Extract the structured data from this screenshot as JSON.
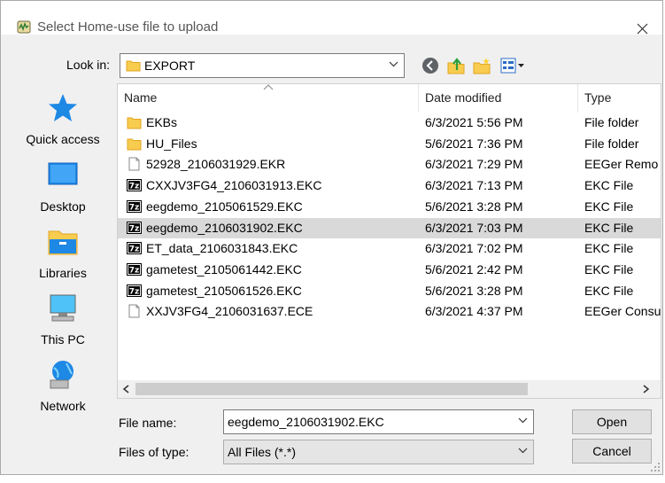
{
  "dialog": {
    "title": "Select Home-use file to upload",
    "look_in_label": "Look in:",
    "look_in_value": "EXPORT",
    "file_name_label": "File name:",
    "file_name_value": "eegdemo_2106031902.EKC",
    "files_of_type_label": "Files of type:",
    "files_of_type_value": "All Files (*.*)",
    "open_label": "Open",
    "cancel_label": "Cancel"
  },
  "places": [
    {
      "label": "Quick access",
      "icon": "star-icon"
    },
    {
      "label": "Desktop",
      "icon": "desktop-icon"
    },
    {
      "label": "Libraries",
      "icon": "libraries-icon"
    },
    {
      "label": "This PC",
      "icon": "computer-icon"
    },
    {
      "label": "Network",
      "icon": "network-icon"
    }
  ],
  "columns": {
    "name": "Name",
    "date": "Date modified",
    "type": "Type"
  },
  "files": [
    {
      "name": "EKBs",
      "date": "6/3/2021 5:56 PM",
      "type": "File folder",
      "icon": "folder"
    },
    {
      "name": "HU_Files",
      "date": "5/6/2021 7:36 PM",
      "type": "File folder",
      "icon": "folder"
    },
    {
      "name": "52928_2106031929.EKR",
      "date": "6/3/2021 7:29 PM",
      "type": "EEGer Remo",
      "icon": "doc"
    },
    {
      "name": "CXXJV3FG4_2106031913.EKC",
      "date": "6/3/2021 7:13 PM",
      "type": "EKC File",
      "icon": "7z"
    },
    {
      "name": "eegdemo_2105061529.EKC",
      "date": "5/6/2021 3:28 PM",
      "type": "EKC File",
      "icon": "7z"
    },
    {
      "name": "eegdemo_2106031902.EKC",
      "date": "6/3/2021 7:03 PM",
      "type": "EKC File",
      "icon": "7z",
      "selected": true
    },
    {
      "name": "ET_data_2106031843.EKC",
      "date": "6/3/2021 7:02 PM",
      "type": "EKC File",
      "icon": "7z"
    },
    {
      "name": "gametest_2105061442.EKC",
      "date": "5/6/2021 2:42 PM",
      "type": "EKC File",
      "icon": "7z"
    },
    {
      "name": "gametest_2105061526.EKC",
      "date": "5/6/2021 3:28 PM",
      "type": "EKC File",
      "icon": "7z"
    },
    {
      "name": "XXJV3FG4_2106031637.ECE",
      "date": "6/3/2021 4:37 PM",
      "type": "EEGer Consu",
      "icon": "doc"
    }
  ],
  "colors": {
    "folder": "#f8cc4f",
    "selection": "#d9d9d9",
    "accent": "#1a73e8"
  }
}
